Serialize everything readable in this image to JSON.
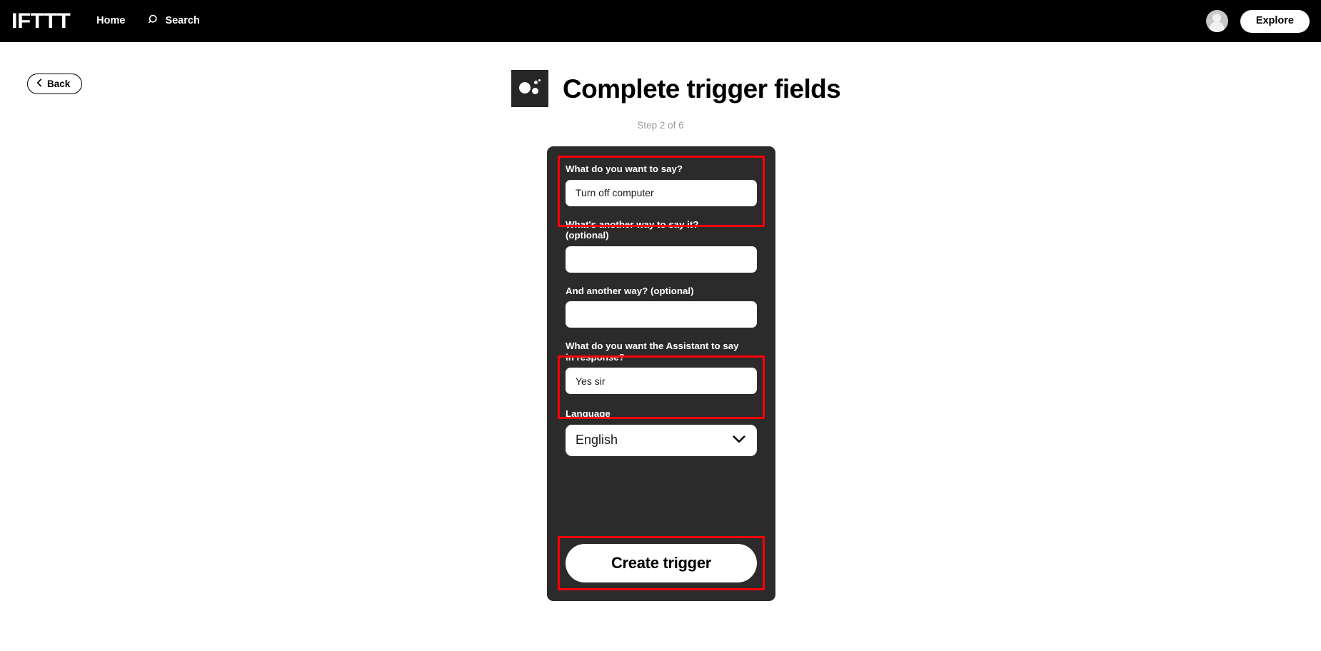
{
  "navbar": {
    "brand": "IFTTT",
    "links": [
      {
        "label": "Home",
        "icon": ""
      },
      {
        "label": "Search",
        "icon": "search-icon"
      }
    ],
    "avatar_icon": "user-avatar-icon",
    "explore_label": "Explore"
  },
  "back": {
    "label": "Back",
    "icon": "chevron-left-icon"
  },
  "header": {
    "service_icon": "google-assistant-icon",
    "title": "Complete trigger fields",
    "step": "Step 2 of 6"
  },
  "form": {
    "fields": [
      {
        "label": "What do you want to say?",
        "value": "Turn off computer",
        "placeholder": "",
        "highlighted": true
      },
      {
        "label": "What's another way to say it?\n(optional)",
        "value": "",
        "placeholder": "",
        "highlighted": false
      },
      {
        "label": "And another way? (optional)",
        "value": "",
        "placeholder": "",
        "highlighted": false
      },
      {
        "label": "What do you want the Assistant to say\nin response?",
        "value": "Yes sir",
        "placeholder": "",
        "highlighted": true
      }
    ],
    "language": {
      "label": "Language",
      "selected": "English",
      "chevron_icon": "chevron-down-icon"
    },
    "submit_label": "Create trigger"
  },
  "colors": {
    "nav_background": "#000000",
    "page_background": "#ffffff",
    "card_background": "#2b2b2b",
    "service_icon_background": "#262626",
    "highlight_border": "#fb0007",
    "step_text": "#9b9b9b",
    "input_background": "#ffffff"
  }
}
